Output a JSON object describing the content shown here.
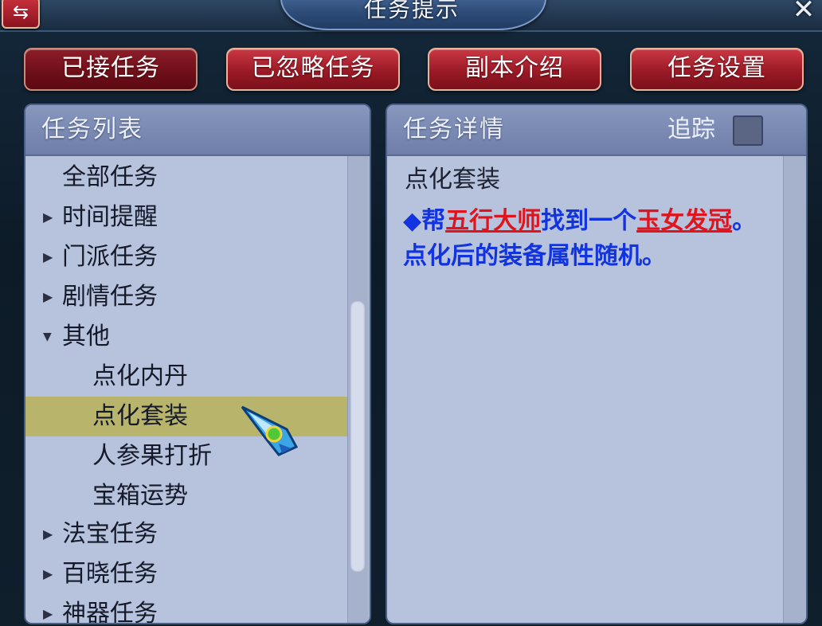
{
  "window": {
    "title": "任务提示",
    "swap_icon": "⇆",
    "close_icon": "✕"
  },
  "tabs": [
    {
      "label": "已接任务",
      "active": true
    },
    {
      "label": "已忽略任务",
      "active": false
    },
    {
      "label": "副本介绍",
      "active": false
    },
    {
      "label": "任务设置",
      "active": false
    }
  ],
  "task_list": {
    "header": "任务列表",
    "items": [
      {
        "label": "全部任务",
        "arrow": ""
      },
      {
        "label": "时间提醒",
        "arrow": "▶"
      },
      {
        "label": "门派任务",
        "arrow": "▶"
      },
      {
        "label": "剧情任务",
        "arrow": "▶"
      },
      {
        "label": "其他",
        "arrow": "▼"
      },
      {
        "label": "点化内丹",
        "arrow": ""
      },
      {
        "label": "点化套装",
        "arrow": "",
        "selected": true
      },
      {
        "label": "人参果打折",
        "arrow": ""
      },
      {
        "label": "宝箱运势",
        "arrow": ""
      },
      {
        "label": "法宝任务",
        "arrow": "▶"
      },
      {
        "label": "百晓任务",
        "arrow": "▶"
      },
      {
        "label": "神器任务",
        "arrow": "▶"
      }
    ]
  },
  "task_detail": {
    "header": "任务详情",
    "track_label": "追踪",
    "track_checked": false,
    "title": "点化套装",
    "text": {
      "bullet": "◆",
      "part1": "帮",
      "npc": "五行大师",
      "part2": "找到一个",
      "item": "玉女发冠",
      "part3": "。点化后的装备属性随机。"
    }
  },
  "colors": {
    "tab_red": "#9b1a26",
    "panel_bg": "#b7c2dc",
    "selected_row": "#b9b46c",
    "link_red": "#e0141c",
    "text_blue": "#1133e0"
  }
}
